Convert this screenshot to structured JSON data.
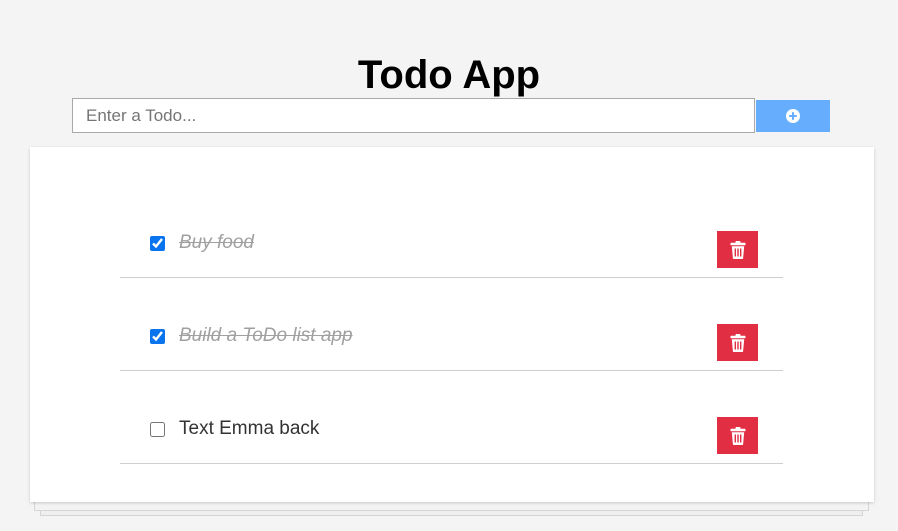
{
  "app": {
    "title": "Todo App"
  },
  "form": {
    "placeholder": "Enter a Todo...",
    "add_icon": "plus-circle-icon",
    "add_button_color": "#66aefd"
  },
  "todos": [
    {
      "text": "Buy food",
      "completed": true
    },
    {
      "text": "Build a ToDo list app",
      "completed": true
    },
    {
      "text": "Text Emma back",
      "completed": false
    }
  ],
  "delete": {
    "icon": "trash-icon",
    "color": "#e12e42"
  },
  "colors": {
    "checkbox_checked": "#0a74ef",
    "background": "#f4f4f4"
  }
}
